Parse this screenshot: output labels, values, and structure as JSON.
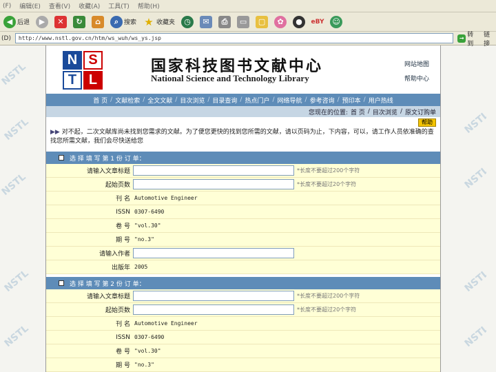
{
  "menu": [
    "(F)",
    "编辑(E)",
    "查看(V)",
    "收藏(A)",
    "工具(T)",
    "帮助(H)"
  ],
  "toolbar": {
    "back": "后退",
    "search": "搜索",
    "favorites": "收藏夹"
  },
  "address": {
    "label": "(D)",
    "url": "http://www.nstl.gov.cn/htm/ws_wuh/ws_ys.jsp",
    "go": "转到",
    "links": "链接"
  },
  "header": {
    "logo_letters": [
      "N",
      "S",
      "T",
      "L"
    ],
    "title_cn": "国家科技图书文献中心",
    "title_en": "National Science and Technology Library",
    "link1": "网站地图",
    "link2": "帮助中心"
  },
  "nav": [
    "首 页",
    "文献检索",
    "全文文献",
    "目次浏览",
    "目录查询",
    "热点门户",
    "网络导航",
    "参考咨询",
    "预印本",
    "用户热线"
  ],
  "crumbs": [
    "您现在的位置:",
    "首 页",
    "目次浏览",
    "原文订购单"
  ],
  "help_label": "帮助",
  "notice": "对不起，二次文献库尚未找到您需求的文献。为了便您更快的找到您所需的文献，请以页码为止，下内容，可以，请工作人员依准确的查找您所需文献，我们会尽快送给您",
  "section1": {
    "title": "选 择 填 写 第 1 份 订 单：",
    "num": "1"
  },
  "section2": {
    "title": "选 择 填 写 第 2 份 订 单：",
    "num": "2"
  },
  "form1": [
    {
      "label": "请输入文章标题",
      "type": "input",
      "hint": "*长度不要超过200个字符"
    },
    {
      "label": "起始页数",
      "type": "input",
      "hint": "*长度不要超过20个字符"
    },
    {
      "label": "刊 名",
      "type": "value",
      "value": "Automotive Engineer"
    },
    {
      "label": "ISSN",
      "type": "value",
      "value": "0307-6490"
    },
    {
      "label": "卷 号",
      "type": "value",
      "value": "\"vol.30\""
    },
    {
      "label": "期 号",
      "type": "value",
      "value": "\"no.3\""
    },
    {
      "label": "请输入作者",
      "type": "input",
      "hint": ""
    },
    {
      "label": "出版年",
      "type": "value",
      "value": "2005"
    }
  ],
  "form2": [
    {
      "label": "请输入文章标题",
      "type": "input",
      "hint": "*长度不要超过200个字符"
    },
    {
      "label": "起始页数",
      "type": "input",
      "hint": "*长度不要超过20个字符"
    },
    {
      "label": "刊 名",
      "type": "value",
      "value": "Automotive Engineer"
    },
    {
      "label": "ISSN",
      "type": "value",
      "value": "0307-6490"
    },
    {
      "label": "卷 号",
      "type": "value",
      "value": "\"vol.30\""
    },
    {
      "label": "期 号",
      "type": "value",
      "value": "\"no.3\""
    }
  ],
  "watermark": "NSTL"
}
